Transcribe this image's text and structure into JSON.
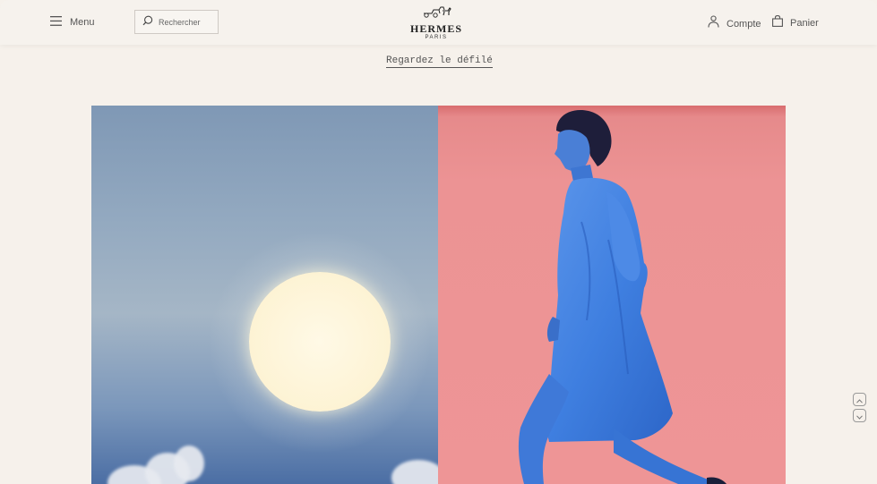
{
  "header": {
    "menu_label": "Menu",
    "search_placeholder": "Rechercher",
    "logo": {
      "brand": "HERMES",
      "city": "PARIS"
    },
    "account_label": "Compte",
    "cart_label": "Panier"
  },
  "main": {
    "show_link": "Regardez le défilé"
  },
  "hero": {
    "left_image": "sun-sky-image",
    "right_image": "model-pink-backdrop-image"
  },
  "icons": {
    "menu": "hamburger-icon",
    "search": "search-icon",
    "account": "user-icon",
    "cart": "bag-icon",
    "scroll_up": "chevron-up-icon",
    "scroll_down": "chevron-down-icon"
  },
  "colors": {
    "background": "#f6f1eb",
    "sky": "#8fa6bf",
    "pink_backdrop": "#ee9596",
    "model_blue": "#3f7fe0"
  }
}
